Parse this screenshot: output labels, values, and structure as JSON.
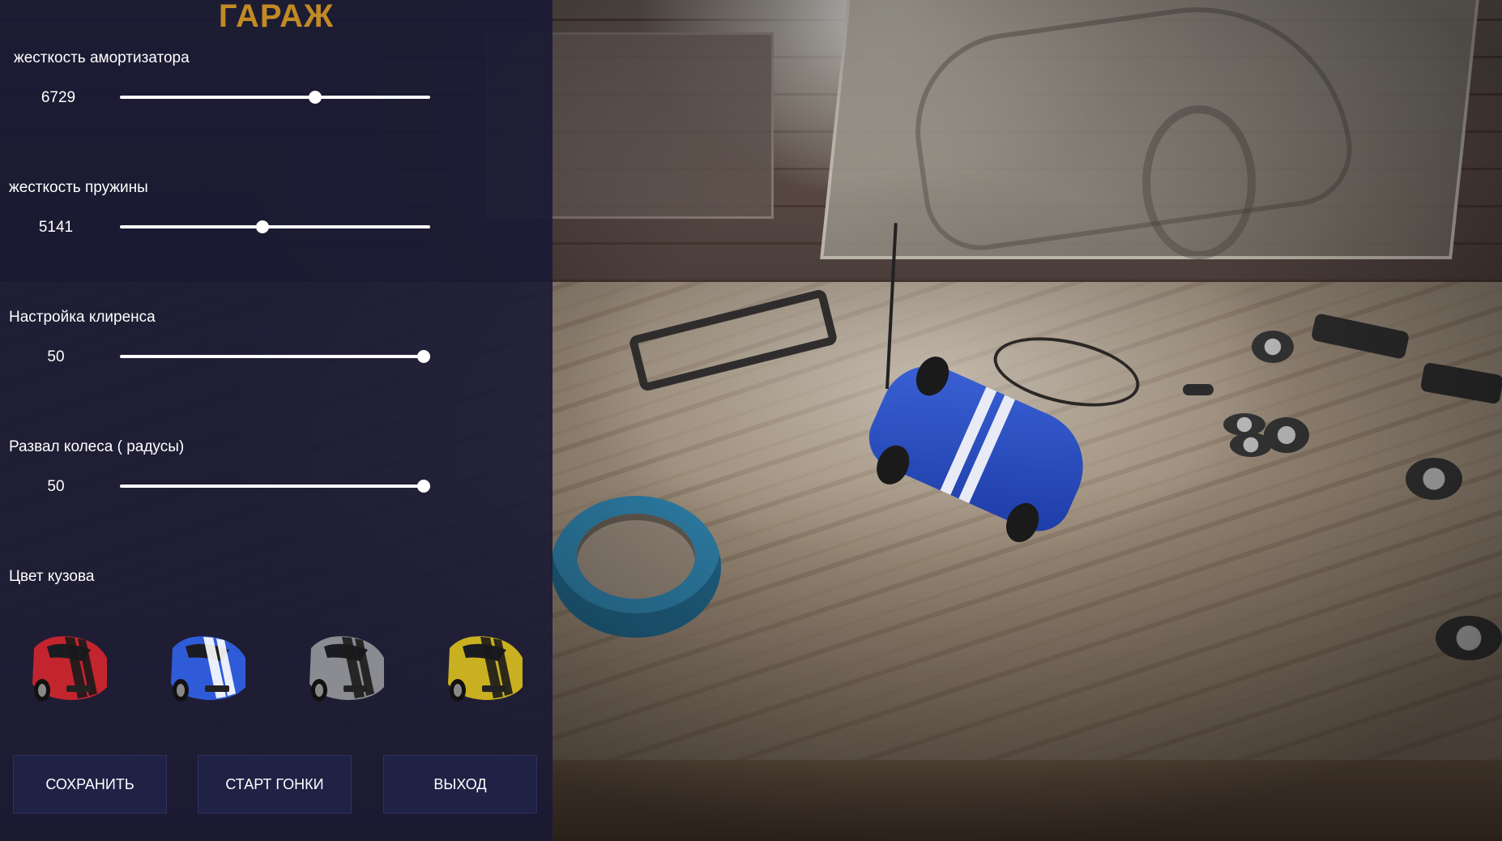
{
  "title": "ГАРАЖ",
  "settings": [
    {
      "label": "жесткость амортизатора",
      "value": "6729",
      "fraction": 0.63
    },
    {
      "label": "жесткость пружины",
      "value": "5141",
      "fraction": 0.46
    },
    {
      "label": "Настройка клиренса",
      "value": "50",
      "fraction": 0.98
    },
    {
      "label": "Развал  колеса ( радусы)",
      "value": "50",
      "fraction": 0.98
    }
  ],
  "color_section": {
    "label": "Цвет кузова",
    "options": [
      {
        "name": "red",
        "color": "#c3252f"
      },
      {
        "name": "blue",
        "color": "#2f5bd8"
      },
      {
        "name": "gray",
        "color": "#8a8c92"
      },
      {
        "name": "yellow",
        "color": "#c9b020"
      }
    ]
  },
  "buttons": {
    "save": "СОХРАНИТЬ",
    "start": "СТАРТ ГОНКИ",
    "exit": "ВЫХОД"
  },
  "scene": {
    "selected_car_color": "#2f5bd8"
  }
}
